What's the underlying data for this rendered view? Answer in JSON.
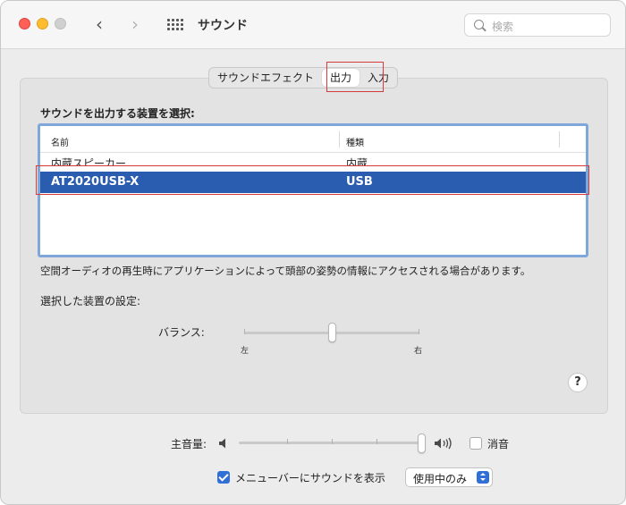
{
  "window": {
    "title": "サウンド",
    "search_placeholder": "検索",
    "back_icon": "‹",
    "forward_icon": "›"
  },
  "tabs": [
    {
      "label": "サウンドエフェクト",
      "active": false
    },
    {
      "label": "出力",
      "active": true
    },
    {
      "label": "入力",
      "active": false
    }
  ],
  "output": {
    "section_label": "サウンドを出力する装置を選択:",
    "columns": {
      "name": "名前",
      "type": "種類"
    },
    "devices": [
      {
        "name": "内蔵スピーカー",
        "type": "内蔵",
        "selected": false
      },
      {
        "name": "AT2020USB-X",
        "type": "USB",
        "selected": true
      }
    ],
    "info_text": "空間オーディオの再生時にアプリケーションによって頭部の姿勢の情報にアクセスされる場合があります。",
    "settings_label": "選択した装置の設定:",
    "balance": {
      "label": "バランス:",
      "left": "左",
      "right": "右",
      "value": 0.5
    }
  },
  "help": "?",
  "footer": {
    "volume_label": "主音量:",
    "volume_value": 1.0,
    "mute_label": "消音",
    "mute_checked": false,
    "show_in_menubar_label": "メニューバーにサウンドを表示",
    "show_in_menubar_checked": true,
    "menubar_option": "使用中のみ"
  },
  "colors": {
    "selection": "#2a5db0",
    "accent": "#2f6fd6",
    "annotation": "#d63a3a"
  }
}
